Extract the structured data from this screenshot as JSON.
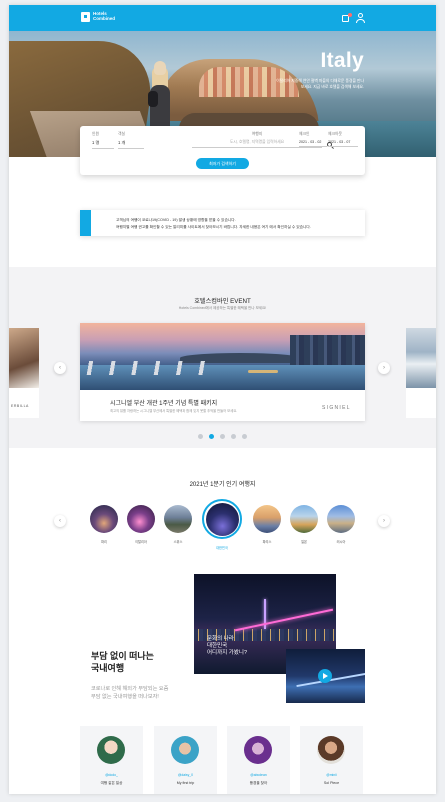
{
  "header": {
    "logo_text": "Hotels Combined",
    "icons": [
      "shopping-bag-icon",
      "user-icon"
    ],
    "accent": "#12a9e3"
  },
  "hero": {
    "title": "Italy",
    "subtitle": "이탈리아 지중해 연안 절벽 마을의 다채로운 풍경을 만나보세요. 지금 바로 호텔을 검색해 보세요."
  },
  "search": {
    "guests_label": "인원",
    "guests_value": "1 명",
    "rooms_label": "객실",
    "rooms_value": "1 개",
    "destination_label": "여행지",
    "destination_placeholder": "도시, 호텔명, 지역명을 입력하세요",
    "checkin_label": "체크인",
    "checkin_value": "2021 - 03 - 02",
    "checkout_label": "체크아웃",
    "checkout_value": "2021 - 03 - 07",
    "button_label": "최저가 검색하기"
  },
  "notice": {
    "line1": "고객님의 여행이 코로나19(COVID - 19) 발생 상황에 영향을 받을 수 있습니다.",
    "line2": "여행지별 여행 권고를 확인할 수 있는 알리미를 사이트에서 찾아보시기 바랍니다. 자세한 내용은 여기 에서 확인하실 수 있습니다."
  },
  "event": {
    "title": "호텔스컴바인 EVENT",
    "subtitle": "Hotels Combined에서 제공하는 특별한 혜택을 만나 보세요!",
    "card_title": "시그니엘 부산 개관 1주년 기념 특별 패키지",
    "card_desc": "최고의 뷰를 자랑하는 시그니엘 부산에서 특별한 혜택과 함께 잊지 못할 추억을 만들어 보세요.",
    "brand": "SIGNIEL",
    "side_left_text": "ERBILLA",
    "active_dot": 1,
    "dot_count": 5
  },
  "popular": {
    "title": "2021년 1분기 인기 여행지",
    "destinations": [
      {
        "name": "파리"
      },
      {
        "name": "이탈리아"
      },
      {
        "name": "스위스"
      },
      {
        "name": "대한민국"
      },
      {
        "name": "파리스"
      },
      {
        "name": "일본"
      },
      {
        "name": "러시아"
      }
    ],
    "selected_index": 3
  },
  "domestic": {
    "title_line1": "부담 없이 떠나는",
    "title_line2": "국내여행",
    "desc_line1": "코로나로 인해 해외가 부담되는 요즘",
    "desc_line2": "부담 없는 국내여행을 떠나보자!",
    "caption_line1": "문화의 나라",
    "caption_line2": "대한민국",
    "caption_line3": "어디까지 가봤니?"
  },
  "profiles": [
    {
      "handle": "@dodo_",
      "name": "여행 같은 일상"
    },
    {
      "handle": "@daisy_0",
      "name": "My first trip"
    },
    {
      "handle": "@abcdean",
      "name": "풍경을 찾아"
    },
    {
      "handle": "@minii",
      "name": "Sol Piece"
    }
  ]
}
